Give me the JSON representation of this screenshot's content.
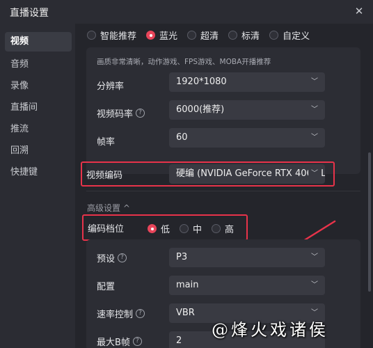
{
  "window": {
    "title": "直播设置"
  },
  "sidebar": {
    "items": [
      {
        "label": "视频",
        "active": true
      },
      {
        "label": "音频"
      },
      {
        "label": "录像"
      },
      {
        "label": "直播间"
      },
      {
        "label": "推流"
      },
      {
        "label": "回溯"
      },
      {
        "label": "快捷键"
      }
    ]
  },
  "quality": {
    "options": [
      "智能推荐",
      "蓝光",
      "超清",
      "标清",
      "自定义"
    ],
    "selected": "蓝光",
    "hint": "画质非常清晰，动作游戏、FPS游戏、MOBA开播推荐"
  },
  "fields": {
    "resolution": {
      "label": "分辨率",
      "value": "1920*1080"
    },
    "bitrate": {
      "label": "视频码率",
      "value": "6000(推荐)"
    },
    "framerate": {
      "label": "帧率",
      "value": "60"
    },
    "encoder": {
      "label": "视频编码",
      "value": "硬编 (NVIDIA GeForce RTX 4060 L"
    }
  },
  "advanced": {
    "toggle_label": "高级设置 ^",
    "level_label": "编码档位",
    "levels": [
      "低",
      "中",
      "高"
    ],
    "level_selected": "低",
    "preset": {
      "label": "预设",
      "value": "P3"
    },
    "profile": {
      "label": "配置",
      "value": "main"
    },
    "rate_control": {
      "label": "速率控制",
      "value": "VBR"
    },
    "max_bframes": {
      "label": "最大B帧",
      "value": "2"
    }
  },
  "icons": {
    "close": "close-icon",
    "chevron": "chevron-down-icon",
    "help": "help-circle-icon"
  },
  "colors": {
    "accent": "#e8455a",
    "highlight": "#e8334a"
  },
  "watermark": "@烽火戏诸侯"
}
